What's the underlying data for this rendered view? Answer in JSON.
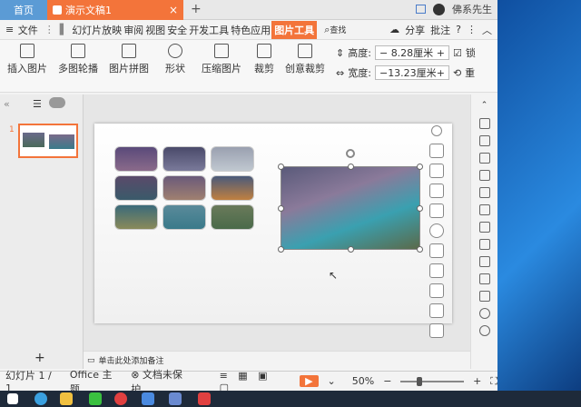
{
  "tabs": {
    "home": "首页",
    "doc": "演示文稿1",
    "add": "+",
    "user": "佛系先生"
  },
  "menu": {
    "file": "文件",
    "items": [
      "幻灯片放映",
      "审阅",
      "视图",
      "安全",
      "开发工具",
      "特色应用"
    ],
    "active": "图片工具",
    "search": "查找",
    "share": "分享",
    "comment": "批注",
    "help": "?"
  },
  "toolbar": {
    "insert_image": "插入图片",
    "multi_carousel": "多图轮播",
    "image_collage": "图片拼图",
    "shape": "形状",
    "compress": "压缩图片",
    "crop": "裁剪",
    "creative_crop": "创意裁剪",
    "height_label": "高度:",
    "height_value": "8.28厘米",
    "width_label": "宽度:",
    "width_value": "13.23厘米",
    "lock_ratio": "锁",
    "reset": "重"
  },
  "left_pane": {
    "slide_num": "1",
    "add": "+"
  },
  "notes": {
    "placeholder": "单击此处添加备注"
  },
  "status": {
    "slide_info": "幻灯片 1 / 1",
    "theme": "Office 主题",
    "protect": "文档未保护",
    "zoom": "50%",
    "minus": "−",
    "plus": "+"
  },
  "colors": {
    "accent": "#f3743a",
    "home_tab": "#5b9bd5",
    "taskbar": "#1e2a3a"
  }
}
